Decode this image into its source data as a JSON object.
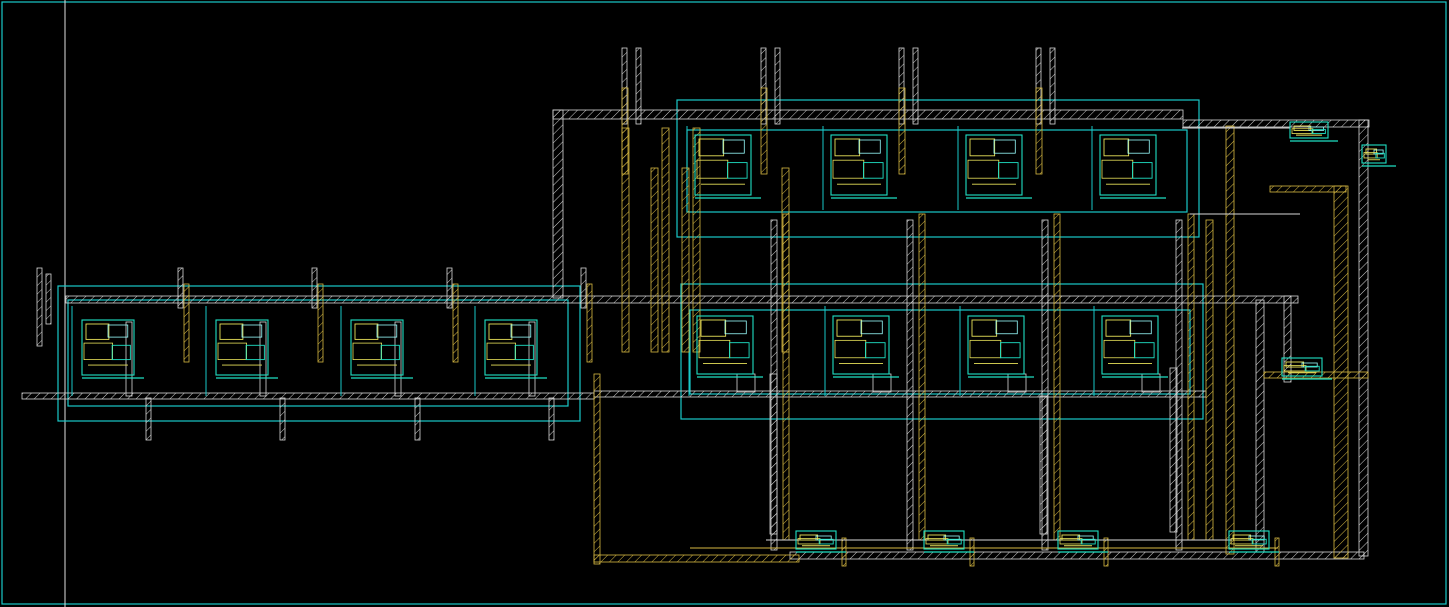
{
  "canvas": {
    "background": "#000000",
    "frame_color": "#19c9c9",
    "axis_line_color": "#d8d8d8"
  },
  "layers": {
    "boundary": {
      "color": "#19c9c9",
      "icon": "cell-boundary"
    },
    "metal1": {
      "color": "#d8d8d8",
      "fill": "#000000",
      "icon": "hatched-gray-wire"
    },
    "metal2": {
      "color": "#d6b842",
      "fill": "#000000",
      "icon": "hatched-yellow-wire"
    },
    "cell_detail": {
      "color": "#1fe0c4",
      "accent": "#e8e25a",
      "icon": "standard-cell"
    }
  },
  "blocks": {
    "left_row": {
      "cells": 4
    },
    "right_top_row": {
      "cells": 4
    },
    "right_bottom_row": {
      "cells": 4
    },
    "bottom_pads": {
      "cells": 4
    },
    "side_cells": {
      "cells": 3
    }
  }
}
